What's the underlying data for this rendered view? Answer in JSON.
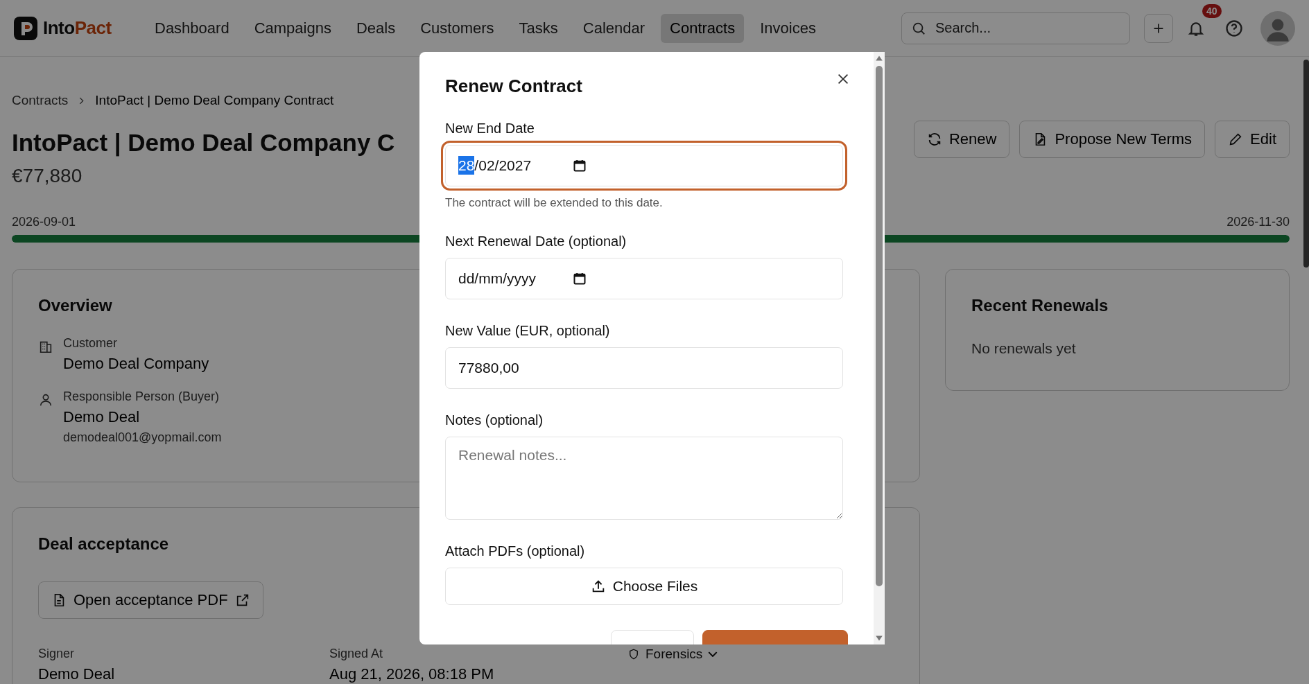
{
  "topbar": {
    "logo": {
      "part_1": "Into",
      "part_2": "Pact"
    },
    "nav": [
      {
        "label": "Dashboard",
        "selected": false
      },
      {
        "label": "Campaigns",
        "selected": false
      },
      {
        "label": "Deals",
        "selected": false
      },
      {
        "label": "Customers",
        "selected": false
      },
      {
        "label": "Tasks",
        "selected": false
      },
      {
        "label": "Calendar",
        "selected": false
      },
      {
        "label": "Contracts",
        "selected": true
      },
      {
        "label": "Invoices",
        "selected": false
      }
    ],
    "search": {
      "placeholder": "Search..."
    },
    "notifications_badge": "40"
  },
  "breadcrumb": [
    "Contracts",
    "IntoPact | Demo Deal Company Contract"
  ],
  "title": "IntoPact | Demo Deal Company C",
  "value": "€77,880",
  "actions": [
    {
      "kind": "renew",
      "label": "Renew"
    },
    {
      "kind": "propose",
      "label": "Propose New Terms"
    },
    {
      "kind": "edit",
      "label": "Edit"
    }
  ],
  "timeline": {
    "start": "2026-09-01",
    "end": "2026-11-30",
    "level": 1
  },
  "overview": {
    "title": "Overview",
    "fields": [
      {
        "kind": "customer",
        "label": "Customer",
        "value": "Demo Deal Company"
      },
      {
        "kind": "person",
        "label": "Responsible Person (Buyer)",
        "value": "Demo Deal",
        "email": "demodeal001@yopmail.com"
      }
    ]
  },
  "recent_renewals": {
    "title": "Recent Renewals",
    "empty": "No renewals yet"
  },
  "deal_acceptance": {
    "title": "Deal acceptance",
    "pdf_button": "Open acceptance PDF",
    "signer_label": "Signer",
    "signer": "Demo Deal",
    "signed_at_label": "Signed At",
    "signed_at": "Aug 21, 2026, 08:18 PM",
    "forensics": "Forensics"
  },
  "modal": {
    "title": "Renew Contract",
    "fields": [
      {
        "kind": "date",
        "label": "New End Date",
        "focused": true,
        "separator": "/",
        "segments": [
          {
            "text": "28",
            "selected": true
          },
          {
            "text": "02",
            "selected": false
          },
          {
            "text": "2027",
            "selected": false
          }
        ],
        "hint": "The contract will be extended to this date."
      },
      {
        "kind": "date-empty",
        "label": "Next Renewal Date (optional)",
        "focused": false,
        "placeholder": "dd/mm/yyyy"
      },
      {
        "kind": "text",
        "label": "New Value (EUR, optional)",
        "focused": false,
        "value": "77880,00"
      },
      {
        "kind": "textarea",
        "label": "Notes (optional)",
        "focused": false,
        "placeholder": "Renewal notes..."
      },
      {
        "kind": "file",
        "label": "Attach PDFs (optional)",
        "focused": false,
        "button": "Choose Files"
      }
    ]
  }
}
